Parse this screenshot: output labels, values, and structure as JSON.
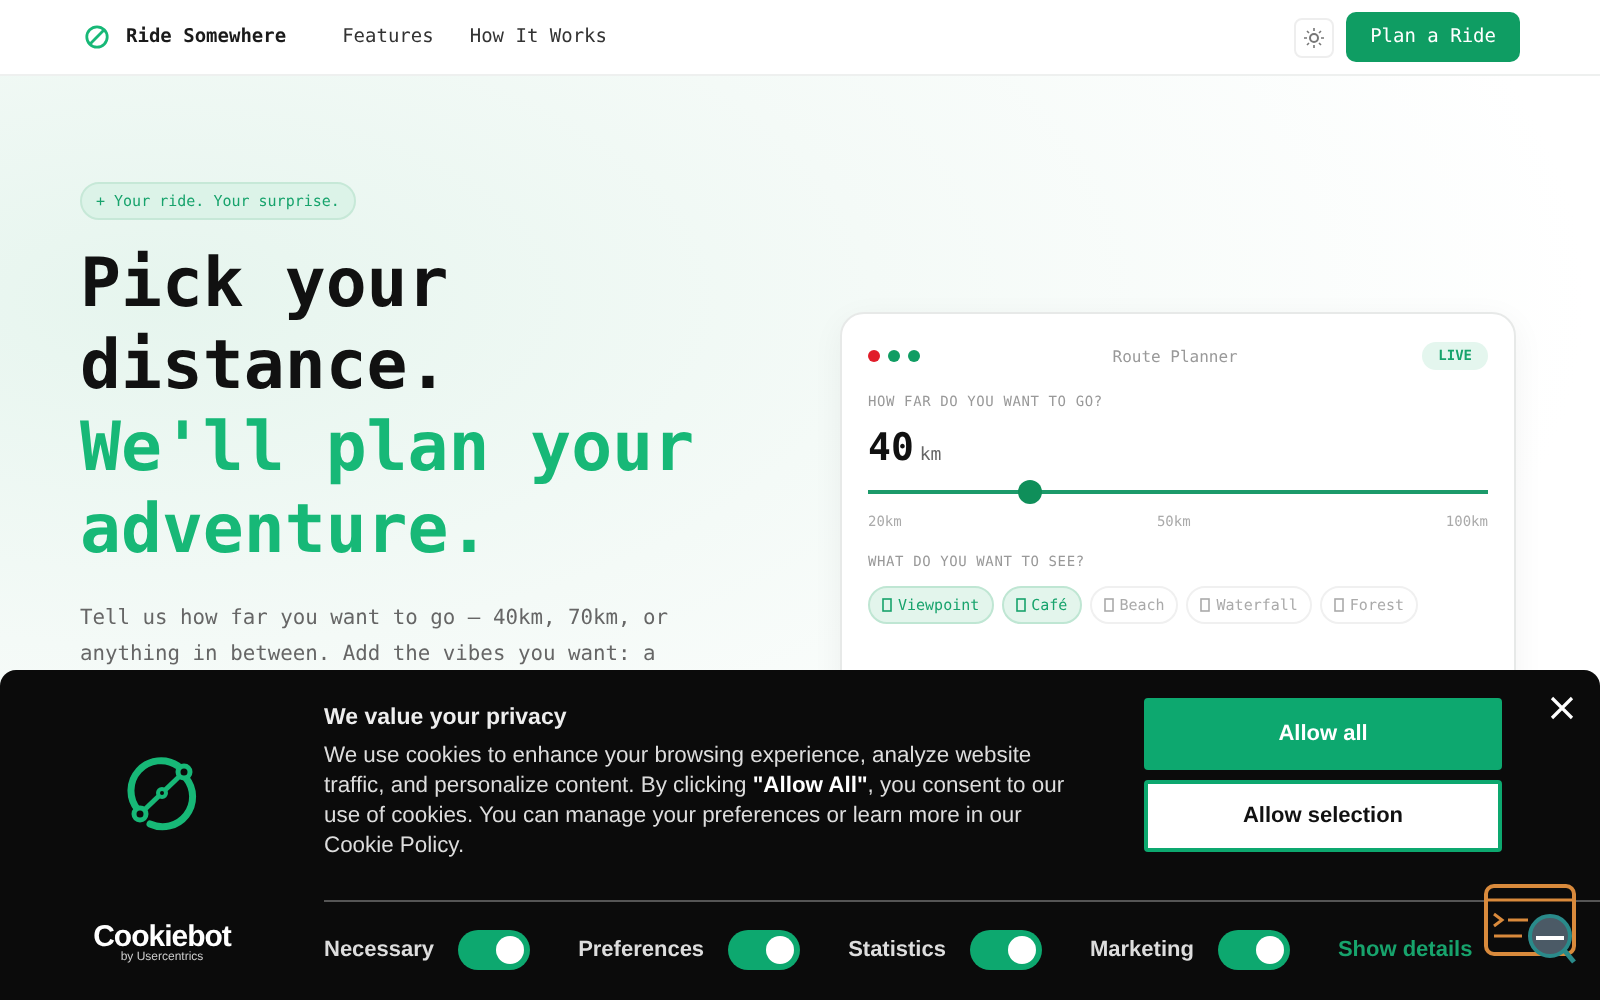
{
  "nav": {
    "brand": "Ride Somewhere",
    "links": [
      "Features",
      "How It Works"
    ],
    "cta": "Plan a Ride"
  },
  "hero": {
    "badge": "+ Your ride. Your surprise.",
    "title_lines": [
      "Pick your",
      "distance."
    ],
    "accent_lines": [
      "We'll plan your",
      "adventure."
    ],
    "intro": "Tell us how far you want to go — 40km, 70km, or anything in between. Add the vibes you want: a"
  },
  "planner": {
    "title": "Route Planner",
    "status": "LIVE",
    "dots": [
      {
        "color": "#e11d2a"
      },
      {
        "color": "#0f9d63"
      },
      {
        "color": "#0f9d63"
      }
    ],
    "distance_label": "HOW FAR DO YOU WANT TO GO?",
    "distance_value": "40",
    "distance_unit": "km",
    "slider": {
      "level": 0.26
    },
    "ticks": [
      "20km",
      "50km",
      "100km"
    ],
    "vibes_label": "WHAT DO YOU WANT TO SEE?",
    "vibes": [
      {
        "label": "Viewpoint",
        "selected": true
      },
      {
        "label": "Café",
        "selected": true
      },
      {
        "label": "Beach",
        "selected": false
      },
      {
        "label": "Waterfall",
        "selected": false
      },
      {
        "label": "Forest",
        "selected": false
      }
    ]
  },
  "cookie_banner": {
    "title": "We value your privacy",
    "body": "We use cookies to enhance your browsing experience, analyze website traffic, and personalize content. By clicking **\"Allow All\"**, you consent to our use of cookies. You can manage your preferences or learn more in our Cookie Policy.",
    "buttons": [
      "Allow all",
      "Allow selection"
    ],
    "brand": "Cookiebot",
    "brand_sub": "by Usercentrics",
    "toggles": [
      {
        "label": "Necessary",
        "on": true
      },
      {
        "label": "Preferences",
        "on": true
      },
      {
        "label": "Statistics",
        "on": true
      },
      {
        "label": "Marketing",
        "on": true
      }
    ],
    "details_link": "Show details"
  }
}
